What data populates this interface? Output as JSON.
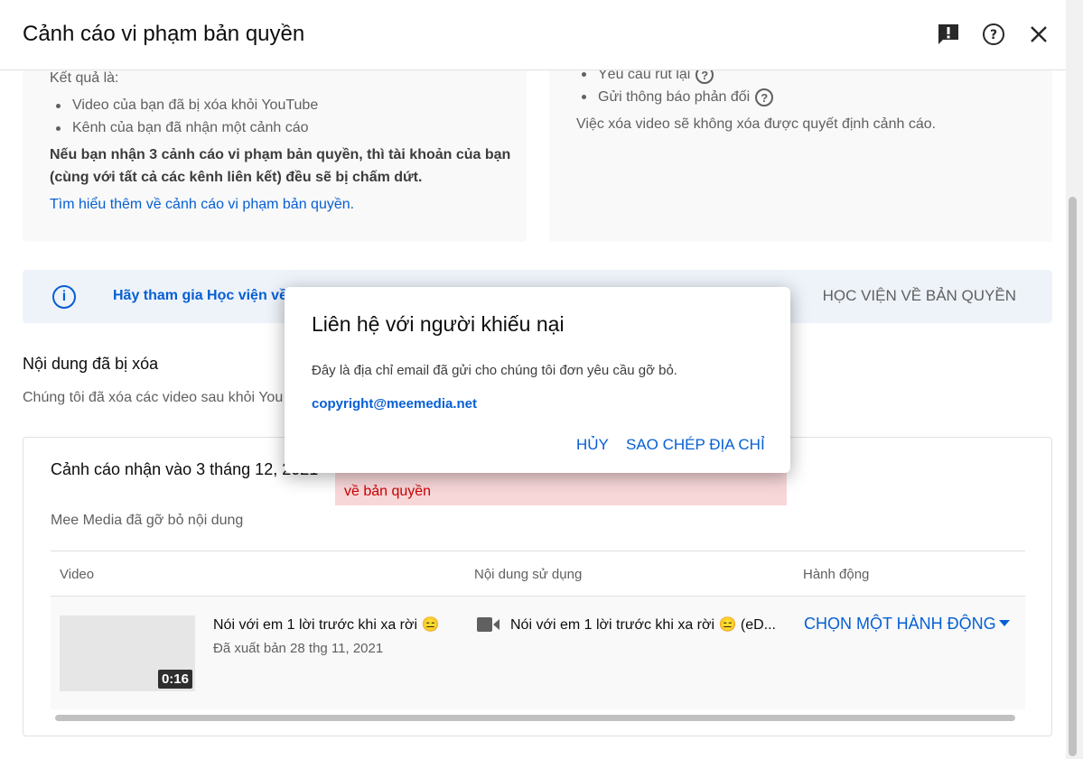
{
  "header": {
    "title": "Cảnh cáo vi phạm bản quyền"
  },
  "left_card": {
    "result_label": "Kết quả là:",
    "bullets": [
      "Video của bạn đã bị xóa khỏi YouTube",
      "Kênh của bạn đã nhận một cảnh cáo"
    ],
    "warning_line1": "Nếu bạn nhận 3 cảnh cáo vi phạm bản quyền, thì tài khoản của bạn",
    "warning_line2": "(cùng với tất cả các kênh liên kết) đều sẽ bị chấm dứt.",
    "learn_more": "Tìm hiểu thêm về cảnh cáo vi phạm bản quyền."
  },
  "right_card": {
    "bullets": [
      "Yêu cầu rút lại",
      "Gửi thông báo phản đối"
    ],
    "note": "Việc xóa video sẽ không xóa được quyết định cảnh cáo."
  },
  "banner": {
    "text": "Hãy tham gia Học viện về b",
    "action": "HỌC VIỆN VỀ BẢN QUYỀN"
  },
  "removed_section": {
    "title": "Nội dung đã bị xóa",
    "description": "Chúng tôi đã xóa các video sau khỏi You"
  },
  "strike": {
    "title": "Cảnh cáo nhận vào 3 tháng 12, 2021",
    "badge": "về bản quyền",
    "subtitle": "Mee Media đã gỡ bỏ nội dung",
    "columns": [
      "Video",
      "Nội dung sử dụng",
      "Hành động"
    ],
    "row": {
      "video_title": "Nói với em 1 lời trước khi xa rời 😑",
      "published": "Đã xuất bản 28 thg 11, 2021",
      "duration": "0:16",
      "content_used": "Nói với em 1 lời trước khi xa rời 😑 (eD...",
      "action": "CHỌN MỘT HÀNH ĐỘNG"
    }
  },
  "dialog": {
    "title": "Liên hệ với người khiếu nại",
    "description": "Đây là địa chỉ email đã gửi cho chúng tôi đơn yêu cầu gỡ bỏ.",
    "email": "copyright@meemedia.net",
    "cancel": "HỦY",
    "copy": "SAO CHÉP ĐỊA CHỈ"
  },
  "colors": {
    "accent": "#065fd4",
    "card_bg": "#f9f9f9",
    "banner_bg": "#eef3fa",
    "badge_bg": "#f8d7d9"
  }
}
